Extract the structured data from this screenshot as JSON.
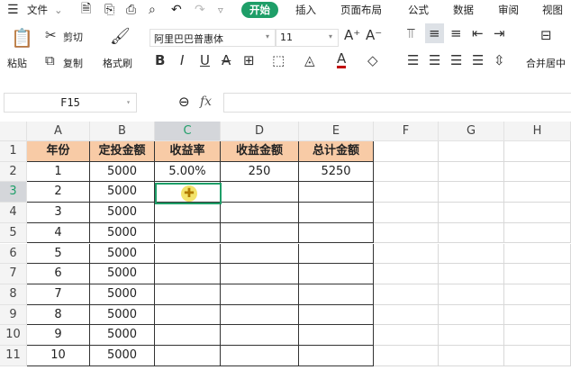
{
  "menubar": {
    "menu_icon": "hamburger-icon",
    "file": "文件",
    "tabs": [
      "开始",
      "插入",
      "页面布局",
      "公式",
      "数据",
      "审阅",
      "视图"
    ]
  },
  "ribbon": {
    "paste": "粘贴",
    "cut": "剪切",
    "copy": "复制",
    "format_painter": "格式刷",
    "font": "阿里巴巴普惠体",
    "size": "11",
    "bold": "B",
    "italic": "I",
    "underline": "U",
    "strike": "A",
    "font_color": "A",
    "merge": "合并居中"
  },
  "formula_bar": {
    "cell_ref": "F15",
    "fx": "fx",
    "value": ""
  },
  "columns": [
    "A",
    "B",
    "C",
    "D",
    "E",
    "F",
    "G",
    "H"
  ],
  "rows": [
    "1",
    "2",
    "3",
    "4",
    "5",
    "6",
    "7",
    "8",
    "9",
    "10",
    "11"
  ],
  "headers": [
    "年份",
    "定投金额",
    "收益率",
    "收益金额",
    "总计金额"
  ],
  "data": [
    [
      "1",
      "5000",
      "5.00%",
      "250",
      "5250"
    ],
    [
      "2",
      "5000",
      "",
      "",
      ""
    ],
    [
      "3",
      "5000",
      "",
      "",
      ""
    ],
    [
      "4",
      "5000",
      "",
      "",
      ""
    ],
    [
      "5",
      "5000",
      "",
      "",
      ""
    ],
    [
      "6",
      "5000",
      "",
      "",
      ""
    ],
    [
      "7",
      "5000",
      "",
      "",
      ""
    ],
    [
      "8",
      "5000",
      "",
      "",
      ""
    ],
    [
      "9",
      "5000",
      "",
      "",
      ""
    ],
    [
      "10",
      "5000",
      "",
      "",
      ""
    ]
  ],
  "colors": {
    "accent": "#1e9e68",
    "header_fill": "#f8cba6"
  }
}
